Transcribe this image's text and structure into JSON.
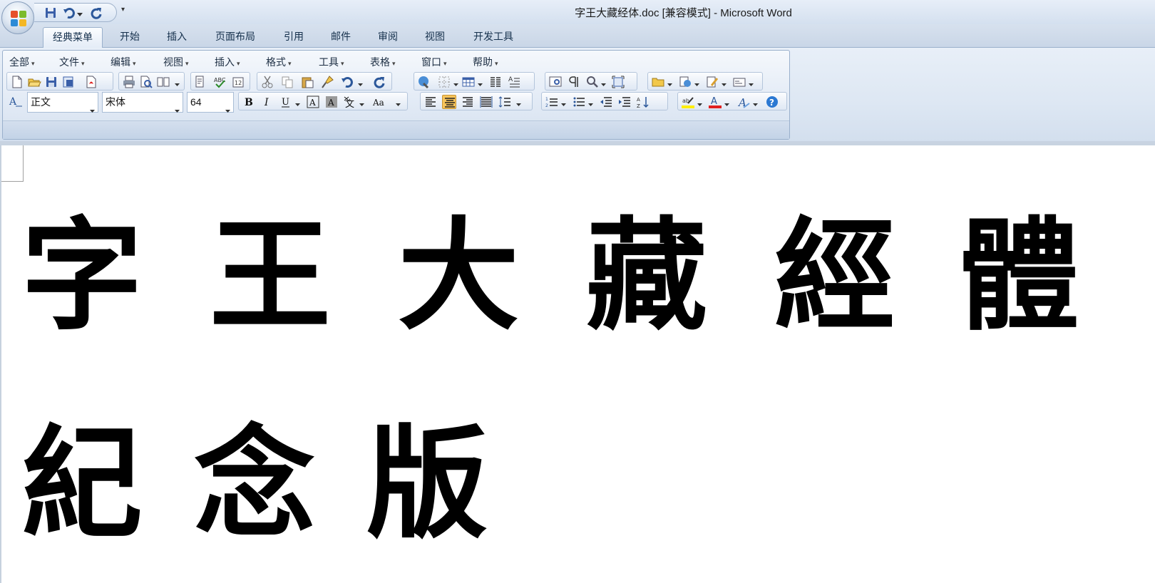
{
  "window": {
    "title": "字王大藏经体.doc [兼容模式] - Microsoft Word"
  },
  "ribbon": {
    "tabs": [
      "经典菜单",
      "开始",
      "插入",
      "页面布局",
      "引用",
      "邮件",
      "审阅",
      "视图",
      "开发工具"
    ],
    "active_tab": "经典菜单"
  },
  "classic_menu": {
    "menus": [
      "全部",
      "文件",
      "编辑",
      "视图",
      "插入",
      "格式",
      "工具",
      "表格",
      "窗口",
      "帮助"
    ]
  },
  "formatting": {
    "style": "正文",
    "font": "宋体",
    "size": "64"
  },
  "document": {
    "glyphs": [
      "字",
      "王",
      "大",
      "藏",
      "經",
      "體",
      "紀",
      "念",
      "版"
    ]
  },
  "colors": {
    "highlight": "#ffee00",
    "font_color": "#e02020",
    "accent": "#2b579a"
  },
  "icons": {
    "quick_access": [
      "save-icon",
      "undo-icon",
      "redo-icon"
    ],
    "toolbar": [
      "new-document-icon",
      "open-icon",
      "save-icon",
      "bold-icon",
      "italic-icon",
      "underline-icon",
      "help-icon"
    ]
  }
}
